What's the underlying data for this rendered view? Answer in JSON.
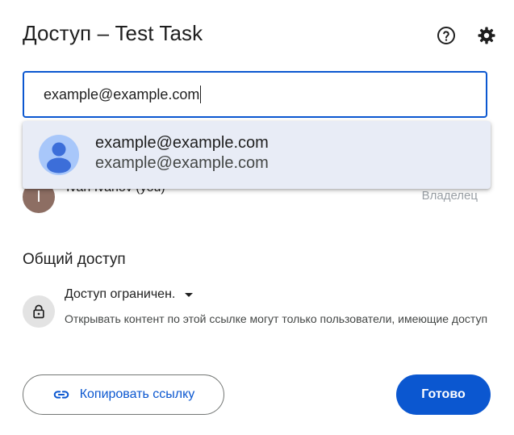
{
  "dialog": {
    "title": "Доступ – Test Task"
  },
  "header": {
    "help_icon": "help-circle-icon",
    "settings_icon": "gear-icon"
  },
  "share_input": {
    "value": "example@example.com"
  },
  "suggestion": {
    "line1": "example@example.com",
    "line2": "example@example.com",
    "avatar_icon": "person-icon"
  },
  "people": [
    {
      "initial": "I",
      "name": "Ivan Ivanov (you)",
      "role": "Владелец"
    }
  ],
  "general_access": {
    "heading": "Общий доступ",
    "selected": "Доступ ограничен.",
    "description": "Открывать контент по этой ссылке могут только пользователи, имеющие доступ",
    "icon": "lock-icon"
  },
  "actions": {
    "copy_link_label": "Копировать ссылку",
    "copy_link_icon": "link-icon",
    "done_label": "Готово"
  },
  "colors": {
    "accent": "#0b57d0",
    "suggestion_bg": "#e8ecf6",
    "avatar_owner": "#8d6e63",
    "avatar_suggestion": "#a8c7fa"
  }
}
